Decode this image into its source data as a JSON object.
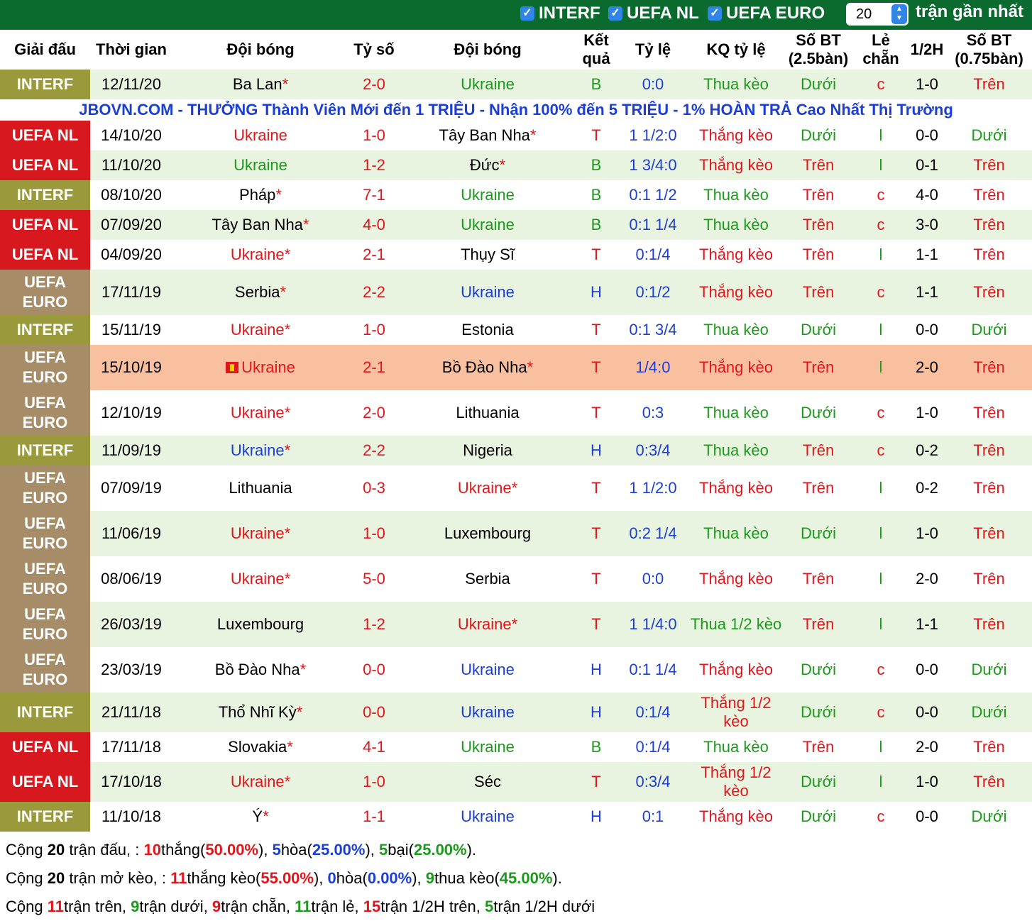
{
  "filters": [
    {
      "label": "INTERF",
      "checked": true
    },
    {
      "label": "UEFA NL",
      "checked": true
    },
    {
      "label": "UEFA EURO",
      "checked": true
    }
  ],
  "recent_count": "20",
  "recent_label": "trận gần nhất",
  "headers": [
    "Giải đấu",
    "Thời gian",
    "Đội bóng",
    "Tỷ số",
    "Đội bóng",
    "Kết quả",
    "Tỷ lệ",
    "KQ tỷ lệ",
    "Số BT (2.5bàn)",
    "Lẻ chẵn",
    "1/2H",
    "Số BT (0.75bàn)"
  ],
  "promo": "JBOVN.COM - THƯỞNG Thành Viên Mới đến 1 TRIỆU - Nhận 100% đến 5 TRIỆU - 1% HOÀN TRẢ Cao Nhất Thị Trường",
  "matches": [
    {
      "league": "INTERF",
      "lt": "interf",
      "date": "12/11/20",
      "home": "Ba Lan",
      "hs": true,
      "hc": "black",
      "score": "2-0",
      "away": "Ukraine",
      "as": false,
      "ac": "green",
      "res": "B",
      "resc": "green",
      "odds": "0:0",
      "kq": "Thua kèo",
      "kqc": "green",
      "bt": "Dưới",
      "btc": "green",
      "lc": "c",
      "lcc": "red",
      "h1": "1-0",
      "bt2": "Trên",
      "bt2c": "red",
      "promo_after": true
    },
    {
      "league": "UEFA NL",
      "lt": "nl",
      "date": "14/10/20",
      "home": "Ukraine",
      "hs": false,
      "hc": "red",
      "score": "1-0",
      "away": "Tây Ban Nha",
      "as": true,
      "ac": "black",
      "res": "T",
      "resc": "red",
      "odds": "1 1/2:0",
      "kq": "Thắng kèo",
      "kqc": "red",
      "bt": "Dưới",
      "btc": "green",
      "lc": "l",
      "lcc": "green",
      "h1": "0-0",
      "bt2": "Dưới",
      "bt2c": "green"
    },
    {
      "league": "UEFA NL",
      "lt": "nl",
      "date": "11/10/20",
      "home": "Ukraine",
      "hs": false,
      "hc": "green",
      "score": "1-2",
      "away": "Đức",
      "as": true,
      "ac": "black",
      "res": "B",
      "resc": "green",
      "odds": "1 3/4:0",
      "kq": "Thắng kèo",
      "kqc": "red",
      "bt": "Trên",
      "btc": "red",
      "lc": "l",
      "lcc": "green",
      "h1": "0-1",
      "bt2": "Trên",
      "bt2c": "red"
    },
    {
      "league": "INTERF",
      "lt": "interf",
      "date": "08/10/20",
      "home": "Pháp",
      "hs": true,
      "hc": "black",
      "score": "7-1",
      "away": "Ukraine",
      "as": false,
      "ac": "green",
      "res": "B",
      "resc": "green",
      "odds": "0:1 1/2",
      "kq": "Thua kèo",
      "kqc": "green",
      "bt": "Trên",
      "btc": "red",
      "lc": "c",
      "lcc": "red",
      "h1": "4-0",
      "bt2": "Trên",
      "bt2c": "red"
    },
    {
      "league": "UEFA NL",
      "lt": "nl",
      "date": "07/09/20",
      "home": "Tây Ban Nha",
      "hs": true,
      "hc": "black",
      "score": "4-0",
      "away": "Ukraine",
      "as": false,
      "ac": "green",
      "res": "B",
      "resc": "green",
      "odds": "0:1 1/4",
      "kq": "Thua kèo",
      "kqc": "green",
      "bt": "Trên",
      "btc": "red",
      "lc": "c",
      "lcc": "red",
      "h1": "3-0",
      "bt2": "Trên",
      "bt2c": "red"
    },
    {
      "league": "UEFA NL",
      "lt": "nl",
      "date": "04/09/20",
      "home": "Ukraine",
      "hs": true,
      "hc": "red",
      "score": "2-1",
      "away": "Thụy Sĩ",
      "as": false,
      "ac": "black",
      "res": "T",
      "resc": "red",
      "odds": "0:1/4",
      "kq": "Thắng kèo",
      "kqc": "red",
      "bt": "Trên",
      "btc": "red",
      "lc": "l",
      "lcc": "green",
      "h1": "1-1",
      "bt2": "Trên",
      "bt2c": "red"
    },
    {
      "league": "UEFA EURO",
      "lt": "euro",
      "date": "17/11/19",
      "home": "Serbia",
      "hs": true,
      "hc": "black",
      "score": "2-2",
      "away": "Ukraine",
      "as": false,
      "ac": "blue",
      "res": "H",
      "resc": "blue",
      "odds": "0:1/2",
      "kq": "Thắng kèo",
      "kqc": "red",
      "bt": "Trên",
      "btc": "red",
      "lc": "c",
      "lcc": "red",
      "h1": "1-1",
      "bt2": "Trên",
      "bt2c": "red"
    },
    {
      "league": "INTERF",
      "lt": "interf",
      "date": "15/11/19",
      "home": "Ukraine",
      "hs": true,
      "hc": "red",
      "score": "1-0",
      "away": "Estonia",
      "as": false,
      "ac": "black",
      "res": "T",
      "resc": "red",
      "odds": "0:1 3/4",
      "kq": "Thua kèo",
      "kqc": "green",
      "bt": "Dưới",
      "btc": "green",
      "lc": "l",
      "lcc": "green",
      "h1": "0-0",
      "bt2": "Dưới",
      "bt2c": "green"
    },
    {
      "league": "UEFA EURO",
      "lt": "euro",
      "date": "15/10/19",
      "home": "Ukraine",
      "hs": false,
      "hc": "red",
      "flag": true,
      "score": "2-1",
      "away": "Bồ Đào Nha",
      "as": true,
      "ac": "black",
      "res": "T",
      "resc": "red",
      "odds": "1/4:0",
      "kq": "Thắng kèo",
      "kqc": "red",
      "bt": "Trên",
      "btc": "red",
      "lc": "l",
      "lcc": "green",
      "h1": "2-0",
      "bt2": "Trên",
      "bt2c": "red",
      "hl": true
    },
    {
      "league": "UEFA EURO",
      "lt": "euro",
      "date": "12/10/19",
      "home": "Ukraine",
      "hs": true,
      "hc": "red",
      "score": "2-0",
      "away": "Lithuania",
      "as": false,
      "ac": "black",
      "res": "T",
      "resc": "red",
      "odds": "0:3",
      "kq": "Thua kèo",
      "kqc": "green",
      "bt": "Dưới",
      "btc": "green",
      "lc": "c",
      "lcc": "red",
      "h1": "1-0",
      "bt2": "Trên",
      "bt2c": "red"
    },
    {
      "league": "INTERF",
      "lt": "interf",
      "date": "11/09/19",
      "home": "Ukraine",
      "hs": true,
      "hc": "blue",
      "score": "2-2",
      "away": "Nigeria",
      "as": false,
      "ac": "black",
      "res": "H",
      "resc": "blue",
      "odds": "0:3/4",
      "kq": "Thua kèo",
      "kqc": "green",
      "bt": "Trên",
      "btc": "red",
      "lc": "c",
      "lcc": "red",
      "h1": "0-2",
      "bt2": "Trên",
      "bt2c": "red"
    },
    {
      "league": "UEFA EURO",
      "lt": "euro",
      "date": "07/09/19",
      "home": "Lithuania",
      "hs": false,
      "hc": "black",
      "score": "0-3",
      "away": "Ukraine",
      "as": true,
      "ac": "red",
      "res": "T",
      "resc": "red",
      "odds": "1 1/2:0",
      "kq": "Thắng kèo",
      "kqc": "red",
      "bt": "Trên",
      "btc": "red",
      "lc": "l",
      "lcc": "green",
      "h1": "0-2",
      "bt2": "Trên",
      "bt2c": "red"
    },
    {
      "league": "UEFA EURO",
      "lt": "euro",
      "date": "11/06/19",
      "home": "Ukraine",
      "hs": true,
      "hc": "red",
      "score": "1-0",
      "away": "Luxembourg",
      "as": false,
      "ac": "black",
      "res": "T",
      "resc": "red",
      "odds": "0:2 1/4",
      "kq": "Thua kèo",
      "kqc": "green",
      "bt": "Dưới",
      "btc": "green",
      "lc": "l",
      "lcc": "green",
      "h1": "1-0",
      "bt2": "Trên",
      "bt2c": "red"
    },
    {
      "league": "UEFA EURO",
      "lt": "euro",
      "date": "08/06/19",
      "home": "Ukraine",
      "hs": true,
      "hc": "red",
      "score": "5-0",
      "away": "Serbia",
      "as": false,
      "ac": "black",
      "res": "T",
      "resc": "red",
      "odds": "0:0",
      "kq": "Thắng kèo",
      "kqc": "red",
      "bt": "Trên",
      "btc": "red",
      "lc": "l",
      "lcc": "green",
      "h1": "2-0",
      "bt2": "Trên",
      "bt2c": "red"
    },
    {
      "league": "UEFA EURO",
      "lt": "euro",
      "date": "26/03/19",
      "home": "Luxembourg",
      "hs": false,
      "hc": "black",
      "score": "1-2",
      "away": "Ukraine",
      "as": true,
      "ac": "red",
      "res": "T",
      "resc": "red",
      "odds": "1 1/4:0",
      "kq": "Thua 1/2 kèo",
      "kqc": "green",
      "bt": "Trên",
      "btc": "red",
      "lc": "l",
      "lcc": "green",
      "h1": "1-1",
      "bt2": "Trên",
      "bt2c": "red"
    },
    {
      "league": "UEFA EURO",
      "lt": "euro",
      "date": "23/03/19",
      "home": "Bồ Đào Nha",
      "hs": true,
      "hc": "black",
      "score": "0-0",
      "away": "Ukraine",
      "as": false,
      "ac": "blue",
      "res": "H",
      "resc": "blue",
      "odds": "0:1 1/4",
      "kq": "Thắng kèo",
      "kqc": "red",
      "bt": "Dưới",
      "btc": "green",
      "lc": "c",
      "lcc": "red",
      "h1": "0-0",
      "bt2": "Dưới",
      "bt2c": "green"
    },
    {
      "league": "INTERF",
      "lt": "interf",
      "date": "21/11/18",
      "home": "Thổ Nhĩ Kỳ",
      "hs": true,
      "hc": "black",
      "score": "0-0",
      "away": "Ukraine",
      "as": false,
      "ac": "blue",
      "res": "H",
      "resc": "blue",
      "odds": "0:1/4",
      "kq": "Thắng 1/2 kèo",
      "kqc": "red",
      "bt": "Dưới",
      "btc": "green",
      "lc": "c",
      "lcc": "red",
      "h1": "0-0",
      "bt2": "Dưới",
      "bt2c": "green"
    },
    {
      "league": "UEFA NL",
      "lt": "nl",
      "date": "17/11/18",
      "home": "Slovakia",
      "hs": true,
      "hc": "black",
      "score": "4-1",
      "away": "Ukraine",
      "as": false,
      "ac": "green",
      "res": "B",
      "resc": "green",
      "odds": "0:1/4",
      "kq": "Thua kèo",
      "kqc": "green",
      "bt": "Trên",
      "btc": "red",
      "lc": "l",
      "lcc": "green",
      "h1": "2-0",
      "bt2": "Trên",
      "bt2c": "red"
    },
    {
      "league": "UEFA NL",
      "lt": "nl",
      "date": "17/10/18",
      "home": "Ukraine",
      "hs": true,
      "hc": "red",
      "score": "1-0",
      "away": "Séc",
      "as": false,
      "ac": "black",
      "res": "T",
      "resc": "red",
      "odds": "0:3/4",
      "kq": "Thắng 1/2 kèo",
      "kqc": "red",
      "bt": "Dưới",
      "btc": "green",
      "lc": "l",
      "lcc": "green",
      "h1": "1-0",
      "bt2": "Trên",
      "bt2c": "red"
    },
    {
      "league": "INTERF",
      "lt": "interf",
      "date": "11/10/18",
      "home": "Ý",
      "hs": true,
      "hc": "black",
      "score": "1-1",
      "away": "Ukraine",
      "as": false,
      "ac": "blue",
      "res": "H",
      "resc": "blue",
      "odds": "0:1",
      "kq": "Thắng kèo",
      "kqc": "red",
      "bt": "Dưới",
      "btc": "green",
      "lc": "c",
      "lcc": "red",
      "h1": "0-0",
      "bt2": "Dưới",
      "bt2c": "green"
    }
  ],
  "summary": [
    [
      [
        "Cộng ",
        ""
      ],
      [
        "20",
        "b"
      ],
      [
        " trận đấu, : ",
        ""
      ],
      [
        "10",
        "br"
      ],
      [
        "thắng(",
        ""
      ],
      [
        "50.00%",
        "br"
      ],
      [
        "), ",
        ""
      ],
      [
        "5",
        "bb"
      ],
      [
        "hòa(",
        ""
      ],
      [
        "25.00%",
        "bb"
      ],
      [
        "), ",
        ""
      ],
      [
        "5",
        "bg"
      ],
      [
        "bại(",
        ""
      ],
      [
        "25.00%",
        "bg"
      ],
      [
        ").",
        ""
      ]
    ],
    [
      [
        "Cộng ",
        ""
      ],
      [
        "20",
        "b"
      ],
      [
        " trận mở kèo, : ",
        ""
      ],
      [
        "11",
        "br"
      ],
      [
        "thắng kèo(",
        ""
      ],
      [
        "55.00%",
        "br"
      ],
      [
        "), ",
        ""
      ],
      [
        "0",
        "bb"
      ],
      [
        "hòa(",
        ""
      ],
      [
        "0.00%",
        "bb"
      ],
      [
        "), ",
        ""
      ],
      [
        "9",
        "bg"
      ],
      [
        "thua kèo(",
        ""
      ],
      [
        "45.00%",
        "bg"
      ],
      [
        ").",
        ""
      ]
    ],
    [
      [
        "Cộng ",
        ""
      ],
      [
        "11",
        "br"
      ],
      [
        "trận trên, ",
        ""
      ],
      [
        "9",
        "bg"
      ],
      [
        "trận dưới, ",
        ""
      ],
      [
        "9",
        "br"
      ],
      [
        "trận chẵn, ",
        ""
      ],
      [
        "11",
        "bg"
      ],
      [
        "trận lẻ, ",
        ""
      ],
      [
        "15",
        "br"
      ],
      [
        "trận 1/2H trên, ",
        ""
      ],
      [
        "5",
        "bg"
      ],
      [
        "trận 1/2H dưới",
        ""
      ]
    ]
  ]
}
